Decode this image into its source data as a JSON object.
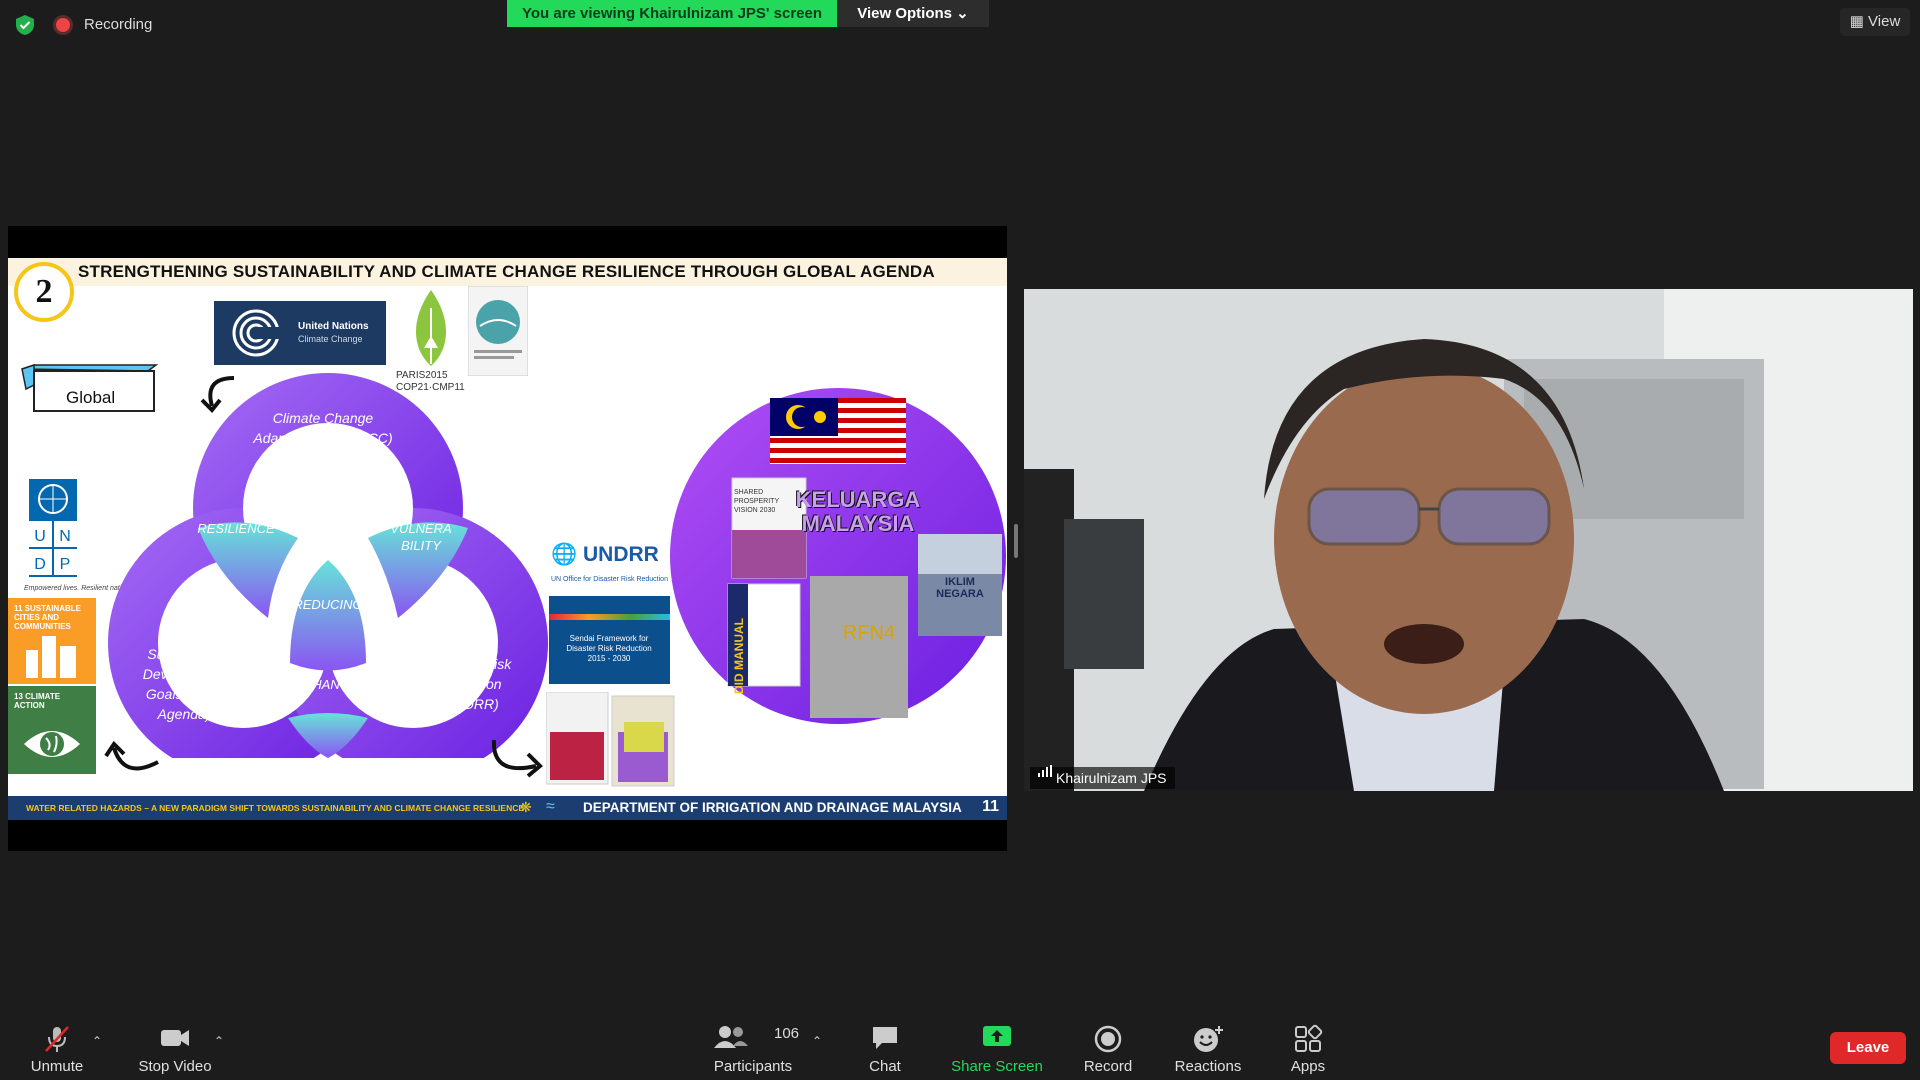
{
  "top_bar": {
    "recording_label": "Recording",
    "banner_text": "You are viewing Khairulnizam JPS' screen",
    "view_options_label": "View Options",
    "view_button_label": "View"
  },
  "slide": {
    "number": "2",
    "title": "STRENGTHENING SUSTAINABILITY AND CLIMATE CHANGE RESILIENCE THROUGH GLOBAL AGENDA",
    "global_label": "Global",
    "unfccc_logo_title": "United Nations",
    "unfccc_logo_subtitle": "Climate Change",
    "paris_line1": "PARIS2015",
    "paris_line2": "COP21·CMP11",
    "undp_caption": "Empowered lives. Resilient nations.",
    "sdg11": "11 SUSTAINABLE CITIES AND COMMUNITIES",
    "sdg13": "13 CLIMATE ACTION",
    "venn": {
      "top": "Climate Change Adaptation (UNFCCC)",
      "left": "Sustainable Development Goals (2030 Agenda)",
      "right": "Disaster Risk Reduction (SFDRR)",
      "resilience": "RESILIENCE",
      "vulnerability": "VULNERA BILITY",
      "reducing": "REDUCING",
      "enhance": "ENHANCE"
    },
    "undrr_name": "UNDRR",
    "undrr_sub": "UN Office for Disaster Risk Reduction",
    "sendai_title": "Sendai Framework for Disaster Risk Reduction 2015 - 2030",
    "keluarga": "KELUARGA MALAYSIA",
    "rfn4": "RFN4",
    "iklim": "IKLIM NEGARA",
    "did_manual": "DID MANUAL",
    "vision": "SHARED PROSPERITY VISION 2030",
    "footer_left": "WATER RELATED HAZARDS – A NEW PARADIGM SHIFT TOWARDS SUSTAINABILITY AND CLIMATE CHANGE RESILIENCE",
    "footer_right": "DEPARTMENT OF IRRIGATION AND DRAINAGE MALAYSIA",
    "page_number": "11"
  },
  "video": {
    "participant_name": "Khairulnizam JPS"
  },
  "toolbar": {
    "unmute": "Unmute",
    "stop_video": "Stop Video",
    "participants": "Participants",
    "participant_count": "106",
    "chat": "Chat",
    "share_screen": "Share Screen",
    "record": "Record",
    "reactions": "Reactions",
    "apps": "Apps",
    "leave": "Leave"
  },
  "colors": {
    "banner_green": "#23d959",
    "share_green": "#23d959",
    "leave_red": "#e02828",
    "venn_purple": "#7b2ff0",
    "slide_footer_blue": "#1b3d6f"
  }
}
